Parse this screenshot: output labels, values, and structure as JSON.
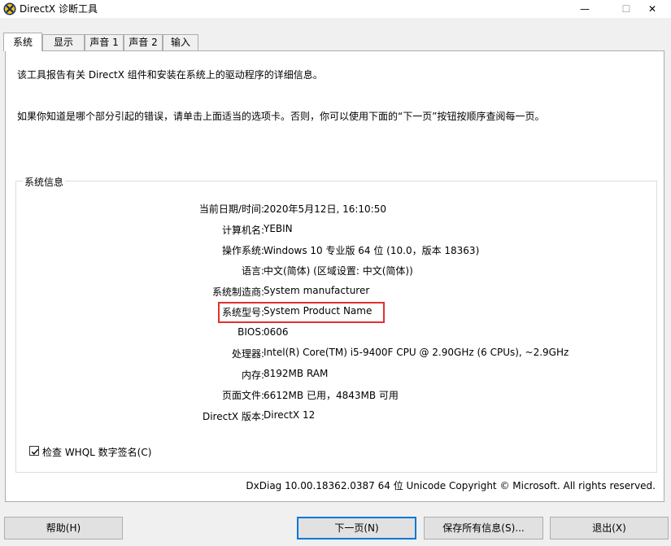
{
  "window": {
    "title": "DirectX 诊断工具",
    "minimize": "—",
    "maximize": "☐",
    "close": "✕"
  },
  "tabs": [
    {
      "label": "系统",
      "active": true
    },
    {
      "label": "显示"
    },
    {
      "label": "声音 1"
    },
    {
      "label": "声音 2"
    },
    {
      "label": "输入"
    }
  ],
  "intro": {
    "line1": "该工具报告有关 DirectX 组件和安装在系统上的驱动程序的详细信息。",
    "line2": "如果你知道是哪个部分引起的错误，请单击上面适当的选项卡。否则，你可以使用下面的“下一页”按钮按顺序查阅每一页。"
  },
  "system_info": {
    "group_label": "系统信息",
    "rows": [
      {
        "label": "当前日期/时间:",
        "value": "2020年5月12日, 16:10:50"
      },
      {
        "label": "计算机名:",
        "value": "YEBIN"
      },
      {
        "label": "操作系统:",
        "value": "Windows 10 专业版 64 位 (10.0，版本 18363)"
      },
      {
        "label": "语言:",
        "value": "中文(简体) (区域设置: 中文(简体))"
      },
      {
        "label": "系统制造商:",
        "value": "System manufacturer"
      },
      {
        "label": "系统型号:",
        "value": "System Product Name"
      },
      {
        "label": "BIOS:",
        "value": "0606"
      },
      {
        "label": "处理器:",
        "value": "Intel(R) Core(TM) i5-9400F CPU @ 2.90GHz (6 CPUs), ~2.9GHz"
      },
      {
        "label": "内存:",
        "value": "8192MB RAM"
      },
      {
        "label": "页面文件:",
        "value": "6612MB 已用，4843MB 可用"
      },
      {
        "label": "DirectX 版本:",
        "value": "DirectX 12"
      }
    ]
  },
  "whql": {
    "label": "检查 WHQL 数字签名(C)",
    "checked": true
  },
  "footer": {
    "version_text": "DxDiag 10.00.18362.0387 64 位 Unicode  Copyright © Microsoft. All rights reserved."
  },
  "buttons": {
    "help": "帮助(H)",
    "next": "下一页(N)",
    "save": "保存所有信息(S)...",
    "exit": "退出(X)"
  },
  "colors": {
    "highlight_border": "#e0312f",
    "primary_button_border": "#0078d7"
  },
  "icons": {
    "app": "directx-x-icon",
    "check": "checkmark-icon"
  }
}
